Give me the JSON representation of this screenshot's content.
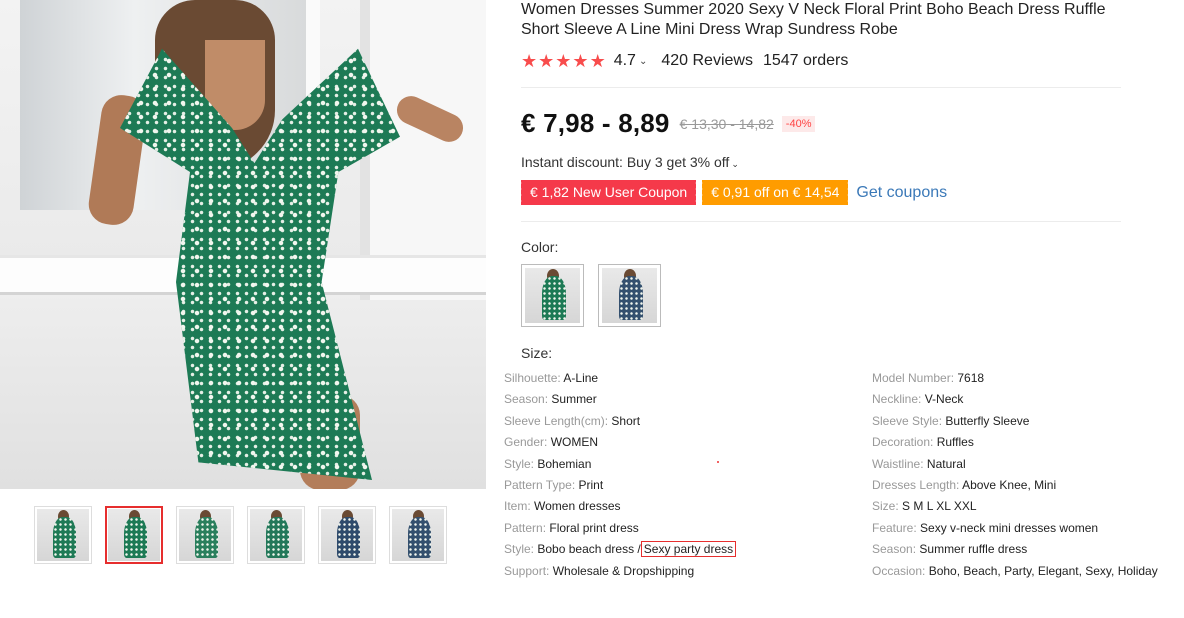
{
  "product": {
    "title": "Women Dresses Summer 2020 Sexy V Neck Floral Print Boho Beach Dress Ruffle Short Sleeve A Line Mini Dress Wrap Sundress Robe",
    "rating": "4.7",
    "reviews": "420 Reviews",
    "orders": "1547 orders",
    "price": "€ 7,98 - 8,89",
    "old_price": "€ 13,30 - 14,82",
    "discount": "-40%",
    "instant_discount": "Instant discount: Buy 3 get 3% off",
    "coupons": [
      {
        "label": "€ 1,82 New User Coupon",
        "color": "#f5394a"
      },
      {
        "label": "€ 0,91 off on € 14,54",
        "color": "#ff9c00"
      }
    ],
    "get_coupons": "Get coupons",
    "color_label": "Color:",
    "size_label": "Size:"
  },
  "gallery": {
    "thumbnails": [
      {
        "dress_color": "#1f7a56"
      },
      {
        "dress_color": "#1d7a55"
      },
      {
        "dress_color": "#2a7f5d"
      },
      {
        "dress_color": "#23785a"
      },
      {
        "dress_color": "#2f4b6c"
      },
      {
        "dress_color": "#34506e"
      }
    ],
    "selected_index": 1
  },
  "swatches": [
    {
      "name": "green",
      "dress_color": "#1d7a55"
    },
    {
      "name": "navy",
      "dress_color": "#34506e"
    }
  ],
  "specs_left": [
    {
      "key": "Silhouette:",
      "value": "A-Line"
    },
    {
      "key": "Season:",
      "value": "Summer"
    },
    {
      "key": "Sleeve Length(cm):",
      "value": "Short"
    },
    {
      "key": "Gender:",
      "value": "WOMEN"
    },
    {
      "key": "Style:",
      "value": "Bohemian"
    },
    {
      "key": "Pattern Type:",
      "value": "Print"
    },
    {
      "key": "Item:",
      "value": "Women dresses"
    },
    {
      "key": "Pattern:",
      "value": "Floral print dress"
    },
    {
      "key": "Style:",
      "value": "Bobo beach dress /",
      "highlight": "Sexy party dress"
    },
    {
      "key": "Support:",
      "value": "Wholesale & Dropshipping"
    }
  ],
  "specs_right": [
    {
      "key": "Model Number:",
      "value": "7618"
    },
    {
      "key": "Neckline:",
      "value": "V-Neck"
    },
    {
      "key": "Sleeve Style:",
      "value": "Butterfly Sleeve"
    },
    {
      "key": "Decoration:",
      "value": "Ruffles"
    },
    {
      "key": "Waistline:",
      "value": "Natural"
    },
    {
      "key": "Dresses Length:",
      "value": "Above Knee, Mini"
    },
    {
      "key": "Size:",
      "value": "S M L XL XXL"
    },
    {
      "key": "Feature:",
      "value": "Sexy v-neck mini dresses women"
    },
    {
      "key": "Season:",
      "value": "Summer ruffle dress"
    },
    {
      "key": "Occasion:",
      "value": "Boho, Beach, Party, Elegant, Sexy, Holiday"
    }
  ],
  "colors": {
    "accent_red": "#f84c4c",
    "link_blue": "#3b79b8",
    "selected_border": "#e62e2e"
  }
}
